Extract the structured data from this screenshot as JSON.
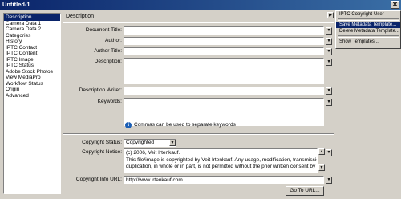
{
  "window": {
    "title": "Untitled-1",
    "close_glyph": "✕"
  },
  "sidebar": {
    "items": [
      {
        "label": "Description",
        "selected": true
      },
      {
        "label": "Camera Data 1"
      },
      {
        "label": "Camera Data 2"
      },
      {
        "label": "Categories"
      },
      {
        "label": "History"
      },
      {
        "label": "IPTC Contact"
      },
      {
        "label": "IPTC Content"
      },
      {
        "label": "IPTC Image"
      },
      {
        "label": "IPTC Status"
      },
      {
        "label": "Adobe Stock Photos"
      },
      {
        "label": "View MediaPro"
      },
      {
        "label": "Workflow Status"
      },
      {
        "label": "Origin"
      },
      {
        "label": "Advanced"
      }
    ]
  },
  "main": {
    "section_title": "Description",
    "fields": {
      "document_title": {
        "label": "Document Title:",
        "value": ""
      },
      "author": {
        "label": "Author:",
        "value": ""
      },
      "author_title": {
        "label": "Author Title:",
        "value": ""
      },
      "description": {
        "label": "Description:",
        "value": ""
      },
      "description_writer": {
        "label": "Description Writer:",
        "value": ""
      },
      "keywords": {
        "label": "Keywords:",
        "value": ""
      }
    },
    "hint": "Commas can be used to separate keywords",
    "copyright_status": {
      "label": "Copyright Status:",
      "value": "Copyrighted"
    },
    "copyright_notice": {
      "label": "Copyright Notice:",
      "line1": "(c) 2006, Veit Irtenkauf.",
      "line2": "This file/image is copyrighted by Veit Irtenkauf.  Any usage, modification, transmission or",
      "line3": "duplication, in whole or in part, is not permitted without the prior written consent by the"
    },
    "copyright_url": {
      "label": "Copyright Info URL:",
      "value": "http://www.irtenkauf.com"
    },
    "goto_button": "Go To URL..."
  },
  "menu": {
    "items": [
      {
        "label": "IPTC Copyright-User"
      },
      {
        "label": "Save Metadata Template...",
        "highlighted": true
      },
      {
        "label": "Delete Metadata Template..."
      },
      {
        "label": "Show Templates..."
      }
    ]
  },
  "icons": {
    "dropdown": "▼",
    "scroll_up": "▲",
    "scroll_down": "▼",
    "menu_arrow": "▶",
    "info": "i"
  }
}
